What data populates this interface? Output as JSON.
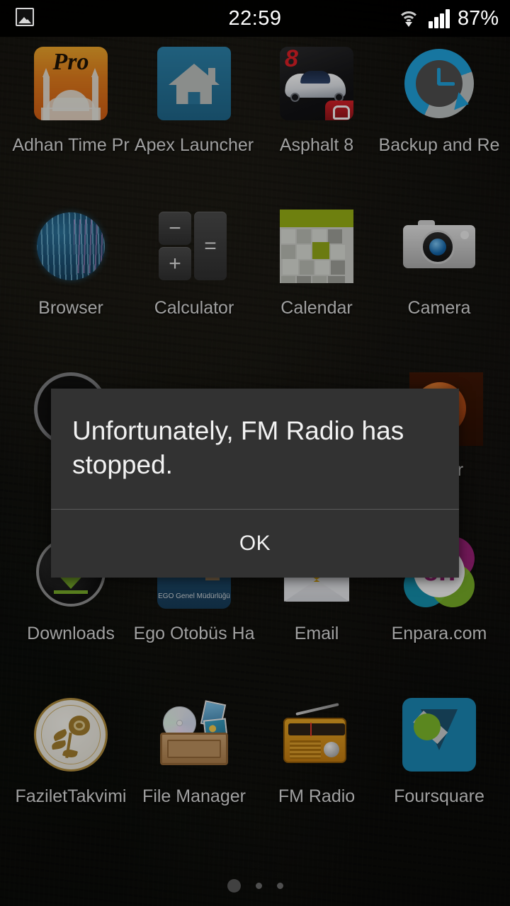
{
  "status_bar": {
    "image_icon": "image-icon",
    "time": "22:59",
    "wifi_icon": "wifi-icon",
    "signal_icon": "signal-bars-icon",
    "battery": "87%"
  },
  "home_screen": {
    "rows": [
      {
        "apps": [
          {
            "label": "Adhan Time Pr",
            "icon": "adhan-time-pro-icon",
            "badge": "Pro"
          },
          {
            "label": "Apex Launcher",
            "icon": "apex-launcher-icon"
          },
          {
            "label": "Asphalt 8",
            "icon": "asphalt-8-icon",
            "badge": "8"
          },
          {
            "label": "Backup and Re",
            "icon": "backup-and-restore-icon"
          }
        ]
      },
      {
        "apps": [
          {
            "label": "Browser",
            "icon": "browser-globe-icon"
          },
          {
            "label": "Calculator",
            "icon": "calculator-icon",
            "keys": [
              "−",
              "+",
              "="
            ]
          },
          {
            "label": "Calendar",
            "icon": "calendar-icon"
          },
          {
            "label": "Camera",
            "icon": "camera-icon"
          }
        ]
      },
      {
        "obscured_by_dialog": true,
        "visible_label": "Haber",
        "apps": [
          {
            "label": "",
            "icon": "round-app-icon-partially-hidden"
          },
          {
            "label": "Haber",
            "icon": "orange-app-icon-partially-hidden"
          }
        ]
      },
      {
        "apps": [
          {
            "label": "Downloads",
            "icon": "downloads-icon"
          },
          {
            "label": "Ego Otobüs Ha",
            "icon": "ego-icon",
            "logo_text": "EGO",
            "logo_sub": "EGO Genel Müdürlüğü"
          },
          {
            "label": "Email",
            "icon": "email-icon",
            "glyph": "@"
          },
          {
            "label": "Enpara.com",
            "icon": "enpara-icon",
            "logo_text": "en"
          }
        ]
      },
      {
        "apps": [
          {
            "label": "FaziletTakvimi",
            "icon": "fazilet-takvimi-icon"
          },
          {
            "label": "File Manager",
            "icon": "file-manager-icon"
          },
          {
            "label": "FM Radio",
            "icon": "fm-radio-icon"
          },
          {
            "label": "Foursquare",
            "icon": "foursquare-icon"
          }
        ]
      }
    ],
    "page_indicator": {
      "total": 3,
      "active_index": 0
    }
  },
  "dialog": {
    "message": "Unfortunately, FM Radio has stopped.",
    "ok_label": "OK",
    "background_color": "#323232",
    "text_color": "#f2f2f2",
    "divider_color": "#5b5b5b"
  }
}
